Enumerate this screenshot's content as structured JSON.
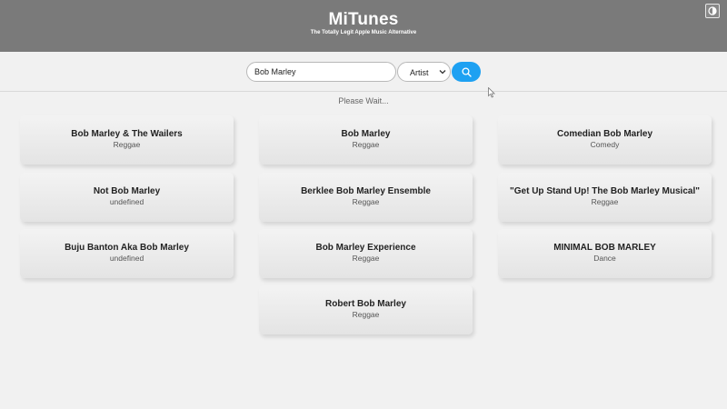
{
  "header": {
    "title": "MiTunes",
    "subtitle": "The Totally Legit Apple Music Alternative",
    "theme_toggle_icon": "contrast-icon"
  },
  "search": {
    "value": "Bob Marley",
    "type_selected": "Artist",
    "button_icon": "search-icon",
    "accent_color": "#1ea1f2"
  },
  "status": "Please Wait...",
  "results": [
    {
      "name": "Bob Marley & The Wailers",
      "genre": "Reggae"
    },
    {
      "name": "Bob Marley",
      "genre": "Reggae"
    },
    {
      "name": "Comedian Bob Marley",
      "genre": "Comedy"
    },
    {
      "name": "Not Bob Marley",
      "genre": "undefined"
    },
    {
      "name": "Berklee Bob Marley Ensemble",
      "genre": "Reggae"
    },
    {
      "name": "\"Get Up Stand Up! The Bob Marley Musical\"",
      "genre": "Reggae"
    },
    {
      "name": "Buju Banton Aka Bob Marley",
      "genre": "undefined"
    },
    {
      "name": "Bob Marley Experience",
      "genre": "Reggae"
    },
    {
      "name": "MINIMAL BOB MARLEY",
      "genre": "Dance"
    },
    {
      "name": "Robert Bob Marley",
      "genre": "Reggae"
    }
  ]
}
